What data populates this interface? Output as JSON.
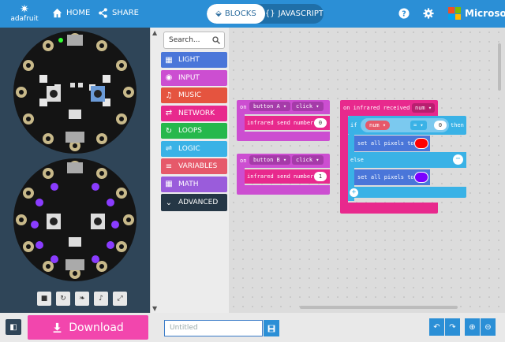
{
  "header": {
    "brand": "adafruit",
    "home_label": "HOME",
    "share_label": "SHARE",
    "blocks_label": "BLOCKS",
    "javascript_label": "JAVASCRIPT",
    "microsoft_label": "Microsoft"
  },
  "toolbox": {
    "search_placeholder": "Search...",
    "categories": [
      {
        "label": "LIGHT",
        "color": "#4a76d9",
        "icon": "grid-icon"
      },
      {
        "label": "INPUT",
        "color": "#cc4ed1",
        "icon": "target-icon"
      },
      {
        "label": "MUSIC",
        "color": "#e5543f",
        "icon": "headphones-icon"
      },
      {
        "label": "NETWORK",
        "color": "#e8298d",
        "icon": "network-icon"
      },
      {
        "label": "LOOPS",
        "color": "#26b84c",
        "icon": "refresh-icon"
      },
      {
        "label": "LOGIC",
        "color": "#3ab2e6",
        "icon": "shuffle-icon"
      },
      {
        "label": "VARIABLES",
        "color": "#e6596a",
        "icon": "list-icon"
      },
      {
        "label": "MATH",
        "color": "#9a5cdb",
        "icon": "calculator-icon"
      },
      {
        "label": "ADVANCED",
        "color": "#253746",
        "icon": "chevron-down-icon"
      }
    ]
  },
  "blocks": {
    "on1": {
      "on": "on",
      "button": "button A",
      "event": "click",
      "send": "infrared send number",
      "value": "0"
    },
    "on2": {
      "on": "on",
      "button": "button B",
      "event": "click",
      "send": "infrared send number",
      "value": "1"
    },
    "ir": {
      "title": "on infrared received",
      "param": "num",
      "if": "if",
      "var": "num",
      "op": "=",
      "cmp": "0",
      "then": "then",
      "set1": "set all pixels to",
      "color1": "#ff0000",
      "else": "else",
      "set2": "set all pixels to",
      "color2": "#7a00ff"
    }
  },
  "footer": {
    "download_label": "Download",
    "project_placeholder": "Untitled"
  }
}
